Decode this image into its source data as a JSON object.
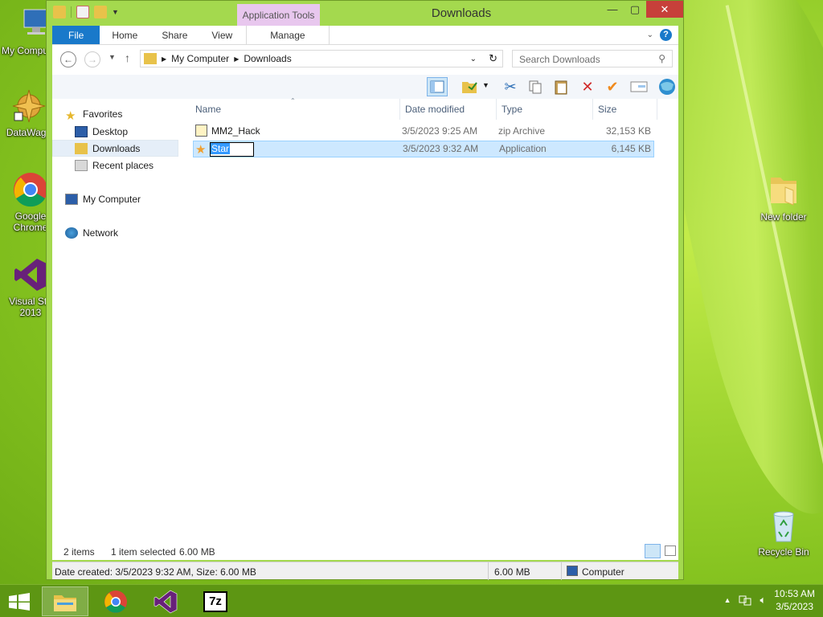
{
  "desktop": {
    "icons": [
      {
        "label": "My Compu"
      },
      {
        "label": "DataWago"
      },
      {
        "label": "Google Chrome"
      },
      {
        "label": "Visual Stu 2013"
      },
      {
        "label": "New folder"
      },
      {
        "label": "Recycle Bin"
      }
    ]
  },
  "window": {
    "title": "Downloads",
    "context_tab": "Application Tools",
    "buttons": {
      "minimize": "—",
      "maximize": "▢",
      "close": "✕"
    }
  },
  "ribbon": {
    "tabs": [
      "File",
      "Home",
      "Share",
      "View",
      "Manage"
    ],
    "help": "?"
  },
  "address": {
    "crumbs": [
      "My Computer",
      "Downloads"
    ],
    "search_placeholder": "Search Downloads"
  },
  "nav": {
    "favorites": "Favorites",
    "desktop": "Desktop",
    "downloads": "Downloads",
    "recent": "Recent places",
    "computer": "My Computer",
    "network": "Network"
  },
  "columns": {
    "name": "Name",
    "date": "Date modified",
    "type": "Type",
    "size": "Size"
  },
  "files": [
    {
      "name": "MM2_Hack",
      "date": "3/5/2023 9:25 AM",
      "type": "zip Archive",
      "size": "32,153 KB"
    },
    {
      "name": "Star",
      "date": "3/5/2023 9:32 AM",
      "type": "Application",
      "size": "6,145 KB"
    }
  ],
  "status": {
    "items": "2 items",
    "selected": "1 item selected",
    "selected_size": "6.00 MB",
    "detail": "Date created: 3/5/2023 9:32 AM, Size: 6.00 MB",
    "detail_size": "6.00 MB",
    "location": "Computer"
  },
  "taskbar": {
    "clock_time": "10:53 AM",
    "clock_date": "3/5/2023",
    "apps": [
      "file-explorer",
      "google-chrome",
      "visual-studio",
      "7-zip"
    ],
    "sevenzip_label": "7z"
  },
  "colors": {
    "accent": "#1979ca",
    "desktop_green": "#9fd531",
    "close_red": "#c7403a",
    "selection": "#cde8ff"
  }
}
